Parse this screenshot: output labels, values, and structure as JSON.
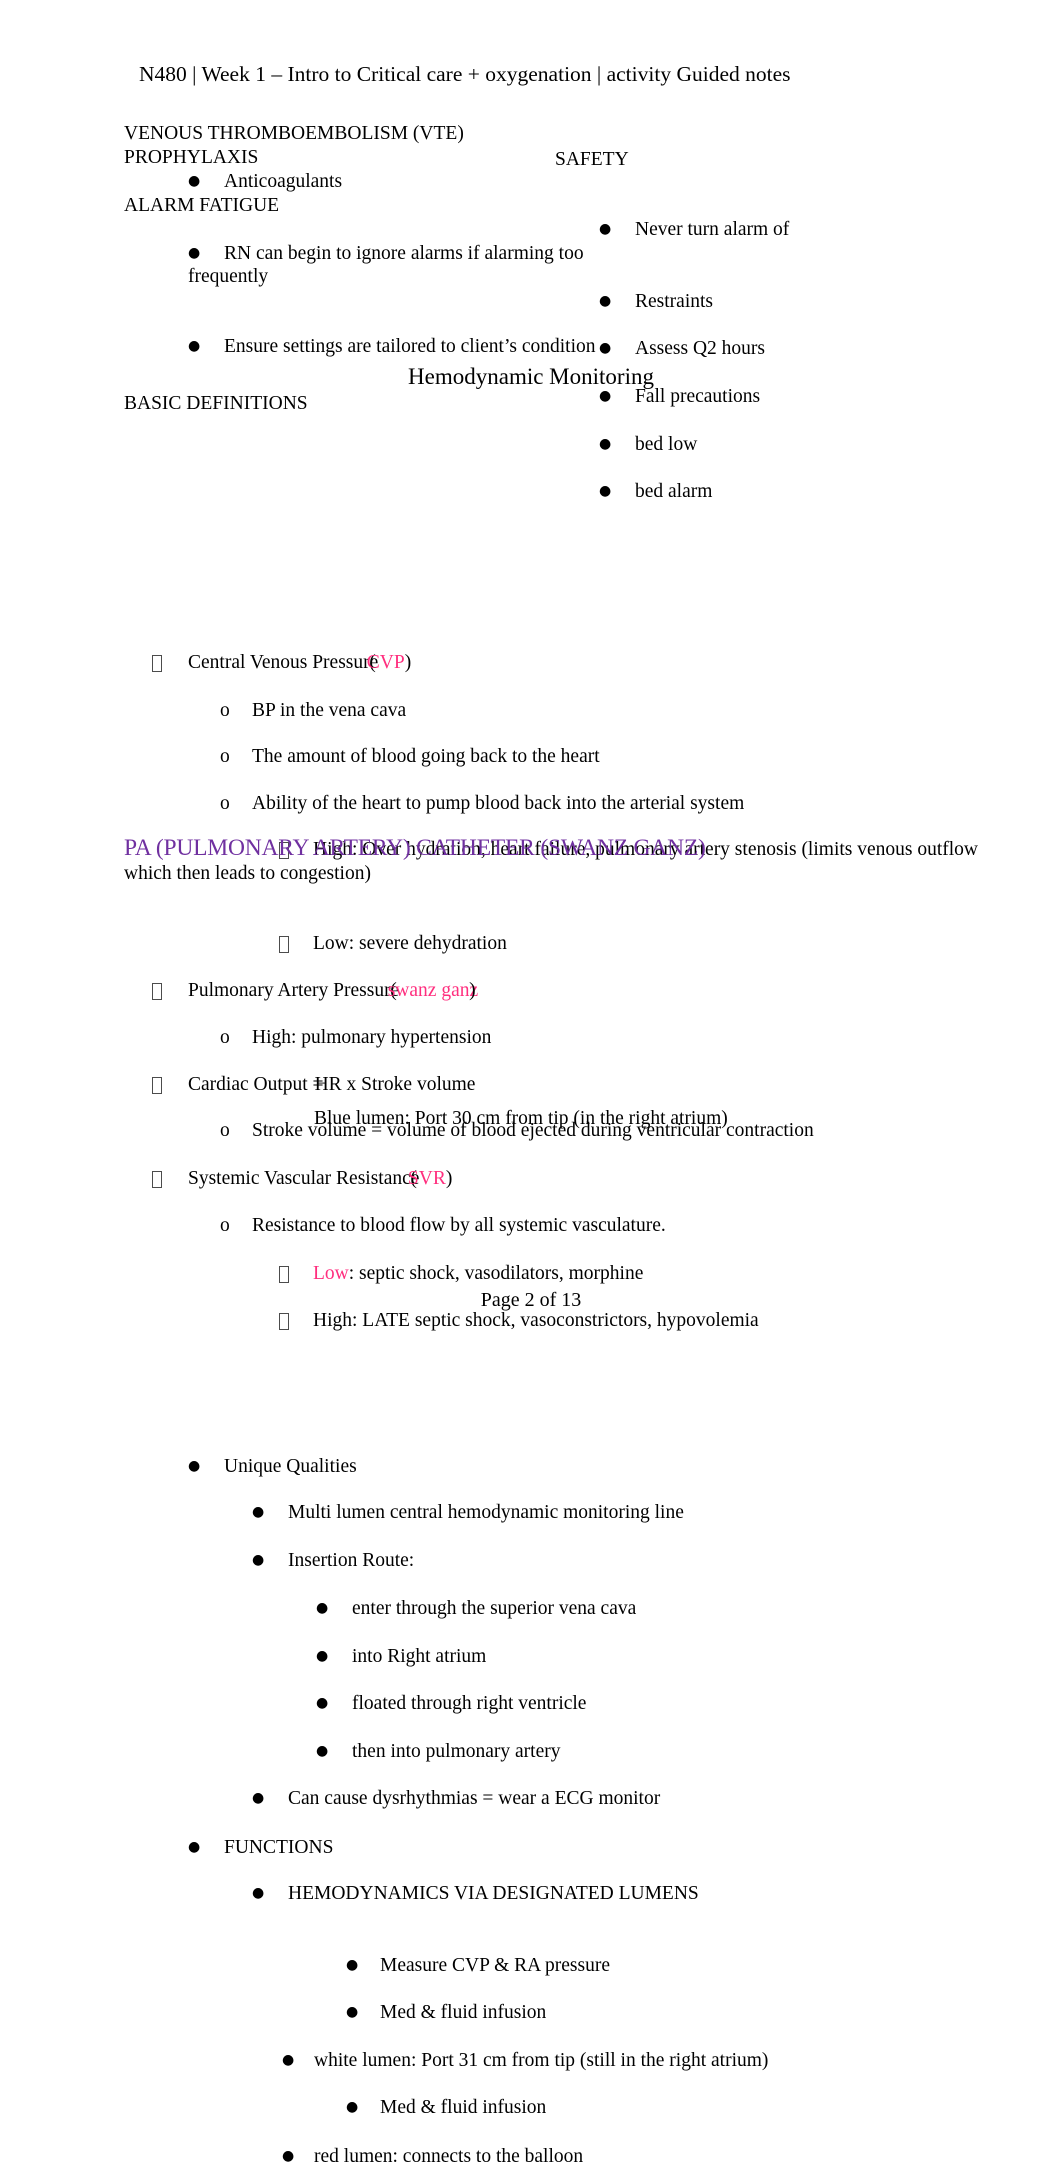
{
  "colors": {
    "pink": "#ff2e7e",
    "purple": "#7030a0",
    "text": "#000000",
    "box_glyph": "#4c4c4c"
  },
  "header": {
    "running_head": "N480 | Week 1 – Intro to Critical care + oxygenation | activity Guided notes"
  },
  "left_column": {
    "heading_1_line_1": "VENOUS THROMBOEMBOLISM (VTE)",
    "heading_1_line_2": "PROPHYLAXIS",
    "item_1": "Anticoagulants",
    "heading_2": "ALARM FATIGUE",
    "item_2": "RN can begin to ignore alarms if alarming too frequently",
    "item_3": "Ensure settings are tailored to client’s condition"
  },
  "right_column": {
    "item_1": "Never turn alarm of",
    "heading_1": "SAFETY",
    "items": [
      "Restraints",
      "Assess Q2 hours",
      "Fall precautions",
      "bed low",
      "bed alarm"
    ]
  },
  "hemodynamic": {
    "title": "Hemodynamic Monitoring",
    "basic_definitions_heading": "BASIC DEFINITIONS",
    "cvp": {
      "label": "Central Venous Pressure",
      "abbrev_open": "(",
      "abbrev": "CVP",
      "abbrev_close": ")",
      "sub_items": [
        "BP in the vena cava",
        "The amount of blood going back to the heart",
        "Ability of the heart to pump blood back into the arterial system"
      ],
      "deep_items": [
        "High: Over hydration, heart failure, pulmonary artery stenosis (limits venous outflow which then leads to congestion)",
        "Low: severe dehydration"
      ]
    },
    "pap": {
      "label": "Pulmonary Artery Pressure",
      "abbrev_open": "(",
      "abbrev": "swanz ganz",
      "abbrev_close": ")",
      "sub_items": [
        "High: pulmonary hypertension"
      ]
    },
    "cardiac_output": {
      "label_a": "Cardiac Output =",
      "label_b": "HR x Stroke volume",
      "sub_items": [
        "Stroke volume = volume of blood ejected during ventricular contraction"
      ]
    },
    "svr": {
      "label": "Systemic Vascular Resistance",
      "abbrev_open": "(",
      "abbrev": "SVR",
      "abbrev_close": ")",
      "sub_items": [
        "Resistance to blood flow by all systemic vasculature."
      ],
      "deep_items": [
        {
          "emphasis": "Low",
          "rest": ": septic shock, vasodilators, morphine"
        },
        {
          "emphasis": "",
          "rest": "High: LATE septic shock, vasoconstrictors, hypovolemia"
        }
      ]
    }
  },
  "pa_catheter": {
    "heading": "PA (PULMONARY ARTERY) CATHETER (SWANZ GANZ)",
    "unique_qualities_label": "Unique Qualities",
    "unique_qualities_items": [
      "Multi lumen central hemodynamic monitoring line",
      "Insertion Route:"
    ],
    "insertion_route_items": [
      "enter through the superior vena cava",
      "into Right atrium",
      "floated through right ventricle",
      "then into pulmonary artery"
    ],
    "dysrhythmias_item": "Can cause dysrhythmias = wear a ECG monitor",
    "functions_label": "FUNCTIONS",
    "hemodynamics_label": "HEMODYNAMICS VIA DESIGNATED LUMENS",
    "blue_lumen": "Blue lumen: Port 30 cm from tip (in the right atrium)",
    "blue_lumen_items": [
      "Measure CVP & RA pressure",
      "Med & fluid infusion"
    ],
    "white_lumen": "white lumen: Port 31 cm from tip (still in the right atrium)",
    "white_lumen_items": [
      "Med & fluid infusion"
    ],
    "red_lumen": "red lumen: connects to the balloon"
  },
  "footer": {
    "page_number": "Page 2 of 13"
  }
}
